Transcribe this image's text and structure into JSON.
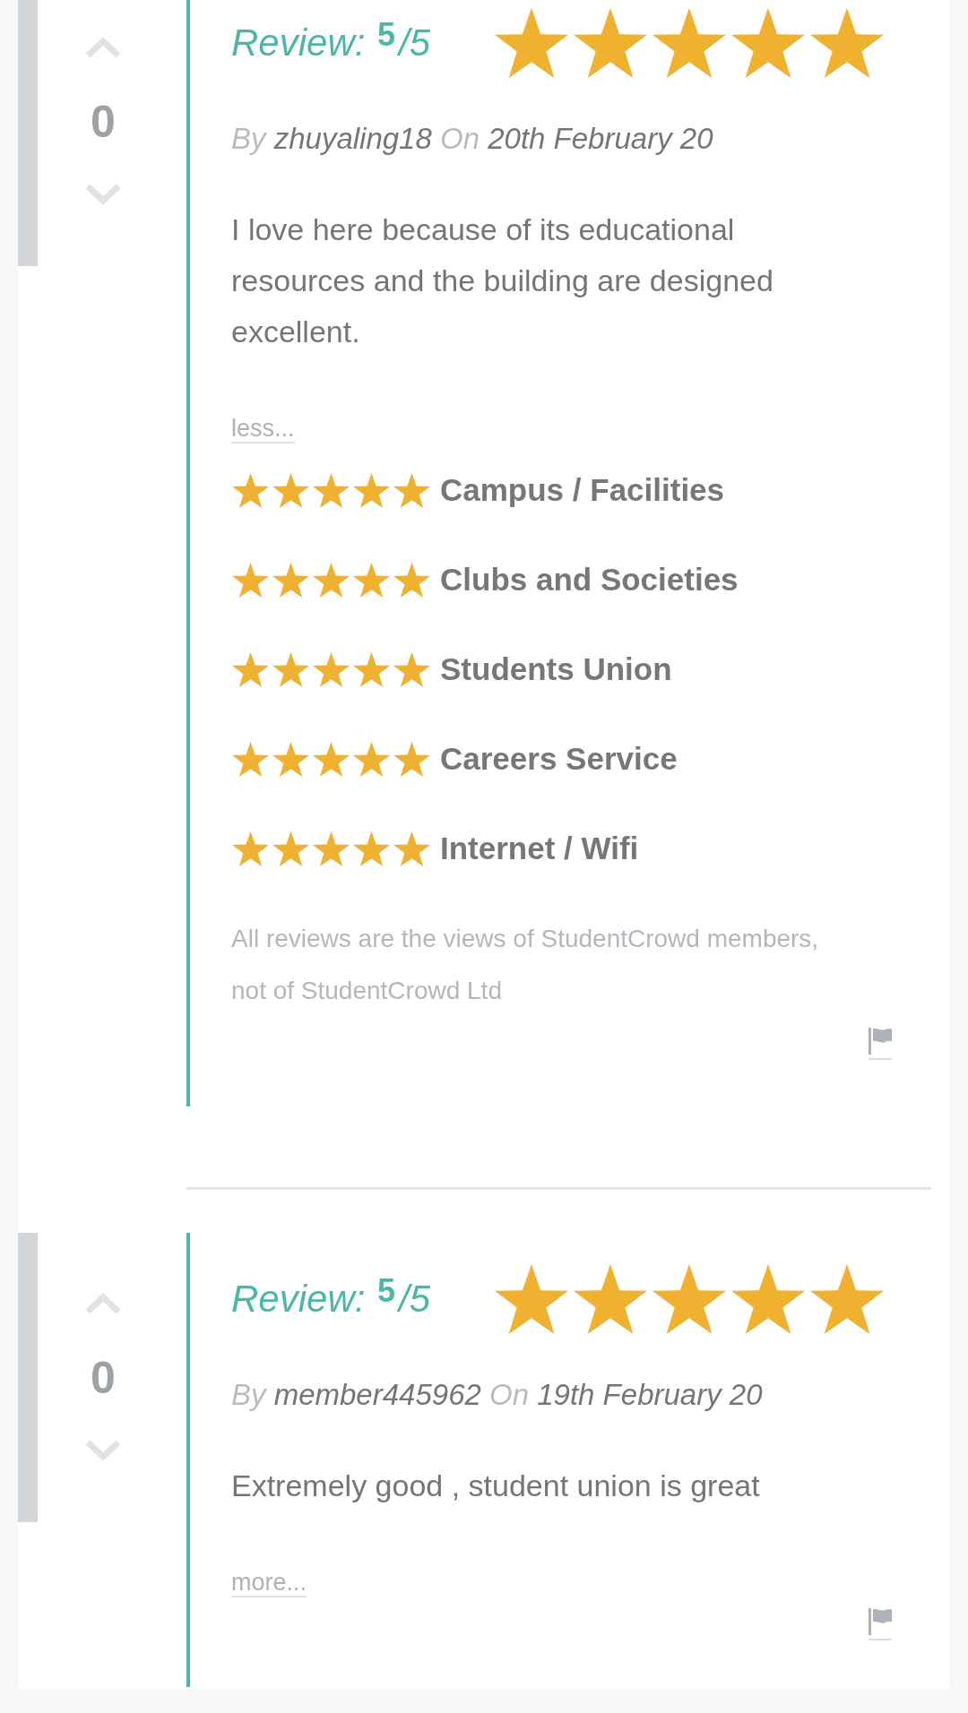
{
  "reviews": [
    {
      "votes": "0",
      "title": "Review: $^{5}$/5",
      "stars": 5,
      "by_label": "By",
      "author": "zhuyaling18",
      "on_label": "On",
      "date": "20th February 20",
      "body": "I love here because of its educational resources and the building are designed excellent.",
      "toggle": "less...",
      "ratings": [
        {
          "label": "Campus / Facilities",
          "stars": 5
        },
        {
          "label": "Clubs and Societies",
          "stars": 5
        },
        {
          "label": "Students Union",
          "stars": 5
        },
        {
          "label": "Careers Service",
          "stars": 5
        },
        {
          "label": "Internet / Wifi",
          "stars": 5
        }
      ],
      "disclaimer": "All reviews are the views of StudentCrowd members, not of StudentCrowd Ltd"
    },
    {
      "votes": "0",
      "title": "Review: $^{5}$/5",
      "stars": 5,
      "by_label": "By",
      "author": "member445962",
      "on_label": "On",
      "date": "19th February 20",
      "body": "Extremely good , student union is great",
      "toggle": "more..."
    }
  ]
}
